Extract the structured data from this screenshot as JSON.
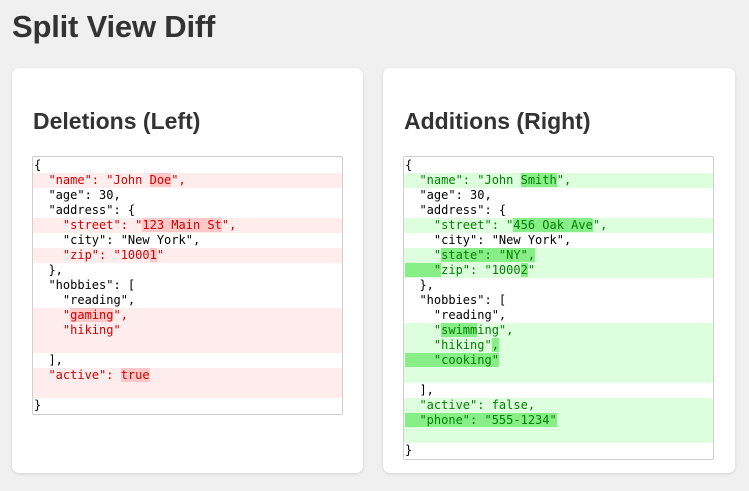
{
  "page": {
    "title": "Split View Diff"
  },
  "left_panel": {
    "title": "Deletions (Left)",
    "lines": [
      {
        "type": "normal",
        "segments": [
          {
            "text": "{",
            "hl": false
          }
        ]
      },
      {
        "type": "del",
        "segments": [
          {
            "text": "  \"name\": \"John ",
            "hl": false
          },
          {
            "text": "Doe",
            "hl": true
          },
          {
            "text": "\",",
            "hl": false
          }
        ]
      },
      {
        "type": "normal",
        "segments": [
          {
            "text": "  \"age\": 30,",
            "hl": false
          }
        ]
      },
      {
        "type": "normal",
        "segments": [
          {
            "text": "  \"address\": {",
            "hl": false
          }
        ]
      },
      {
        "type": "del",
        "segments": [
          {
            "text": "    \"street\": \"",
            "hl": false
          },
          {
            "text": "123 Main St",
            "hl": true
          },
          {
            "text": "\",",
            "hl": false
          }
        ]
      },
      {
        "type": "normal",
        "segments": [
          {
            "text": "    \"city\": \"New York\",",
            "hl": false
          }
        ]
      },
      {
        "type": "del",
        "segments": [
          {
            "text": "    \"zip\": \"1000",
            "hl": false
          },
          {
            "text": "1",
            "hl": true
          },
          {
            "text": "\"",
            "hl": false
          }
        ]
      },
      {
        "type": "normal",
        "segments": [
          {
            "text": "  },",
            "hl": false
          }
        ]
      },
      {
        "type": "normal",
        "segments": [
          {
            "text": "  \"hobbies\": [",
            "hl": false
          }
        ]
      },
      {
        "type": "normal",
        "segments": [
          {
            "text": "    \"reading\",",
            "hl": false
          }
        ]
      },
      {
        "type": "del",
        "segments": [
          {
            "text": "    \"",
            "hl": false
          },
          {
            "text": "gaming",
            "hl": true
          },
          {
            "text": "\",",
            "hl": false
          }
        ]
      },
      {
        "type": "del",
        "segments": [
          {
            "text": "    \"hiking\"",
            "hl": false
          }
        ]
      },
      {
        "type": "del",
        "segments": [
          {
            "text": "",
            "hl": false
          }
        ]
      },
      {
        "type": "normal",
        "segments": [
          {
            "text": "  ],",
            "hl": false
          }
        ]
      },
      {
        "type": "del",
        "segments": [
          {
            "text": "  \"active\": ",
            "hl": false
          },
          {
            "text": "true",
            "hl": true
          }
        ]
      },
      {
        "type": "del",
        "segments": [
          {
            "text": "",
            "hl": false
          }
        ]
      },
      {
        "type": "normal",
        "segments": [
          {
            "text": "}",
            "hl": false
          }
        ]
      }
    ]
  },
  "right_panel": {
    "title": "Additions (Right)",
    "lines": [
      {
        "type": "normal",
        "segments": [
          {
            "text": "{",
            "hl": false
          }
        ]
      },
      {
        "type": "add",
        "segments": [
          {
            "text": "  \"name\": \"John ",
            "hl": false
          },
          {
            "text": "Smith",
            "hl": true
          },
          {
            "text": "\",",
            "hl": false
          }
        ]
      },
      {
        "type": "normal",
        "segments": [
          {
            "text": "  \"age\": 30,",
            "hl": false
          }
        ]
      },
      {
        "type": "normal",
        "segments": [
          {
            "text": "  \"address\": {",
            "hl": false
          }
        ]
      },
      {
        "type": "add",
        "segments": [
          {
            "text": "    \"street\": \"",
            "hl": false
          },
          {
            "text": "456 Oak Ave",
            "hl": true
          },
          {
            "text": "\",",
            "hl": false
          }
        ]
      },
      {
        "type": "normal",
        "segments": [
          {
            "text": "    \"city\": \"New York\",",
            "hl": false
          }
        ]
      },
      {
        "type": "add",
        "segments": [
          {
            "text": "    \"",
            "hl": false
          },
          {
            "text": "state\": \"NY\",",
            "hl": true
          }
        ]
      },
      {
        "type": "add",
        "segments": [
          {
            "text": "    \"",
            "hl": true
          },
          {
            "text": "zip\": \"1000",
            "hl": false
          },
          {
            "text": "2",
            "hl": true
          },
          {
            "text": "\"",
            "hl": false
          }
        ]
      },
      {
        "type": "normal",
        "segments": [
          {
            "text": "  },",
            "hl": false
          }
        ]
      },
      {
        "type": "normal",
        "segments": [
          {
            "text": "  \"hobbies\": [",
            "hl": false
          }
        ]
      },
      {
        "type": "normal",
        "segments": [
          {
            "text": "    \"reading\",",
            "hl": false
          }
        ]
      },
      {
        "type": "add",
        "segments": [
          {
            "text": "    \"",
            "hl": false
          },
          {
            "text": "swimm",
            "hl": true
          },
          {
            "text": "ing\",",
            "hl": false
          }
        ]
      },
      {
        "type": "add",
        "segments": [
          {
            "text": "    \"hiking\"",
            "hl": false
          },
          {
            "text": ",",
            "hl": true
          }
        ]
      },
      {
        "type": "add",
        "segments": [
          {
            "text": "    \"cooking\"",
            "hl": true
          }
        ]
      },
      {
        "type": "add",
        "segments": [
          {
            "text": "",
            "hl": false
          }
        ]
      },
      {
        "type": "normal",
        "segments": [
          {
            "text": "  ],",
            "hl": false
          }
        ]
      },
      {
        "type": "add",
        "segments": [
          {
            "text": "  \"active\": false,",
            "hl": false
          }
        ]
      },
      {
        "type": "add",
        "segments": [
          {
            "text": "  \"phone\": \"555-1234\"",
            "hl": true
          }
        ]
      },
      {
        "type": "add",
        "segments": [
          {
            "text": "",
            "hl": false
          }
        ]
      },
      {
        "type": "normal",
        "segments": [
          {
            "text": "}",
            "hl": false
          }
        ]
      }
    ]
  },
  "colors": {
    "page_bg": "#f0f0f0",
    "deletion_line_bg": "#ffecec",
    "deletion_text": "#d00000",
    "deletion_highlight": "#ffc8c8",
    "addition_line_bg": "#ddffdd",
    "addition_text": "#008000",
    "addition_highlight": "#88ee88"
  }
}
